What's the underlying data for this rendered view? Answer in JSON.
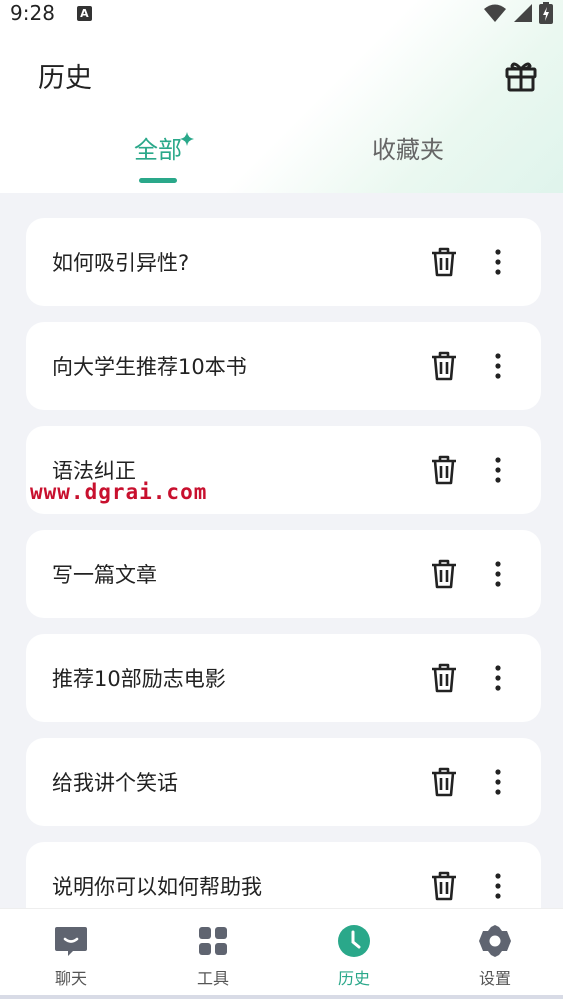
{
  "status": {
    "time": "9:28",
    "a_badge": "A"
  },
  "header": {
    "title": "历史"
  },
  "tabs": [
    {
      "label": "全部",
      "active": true
    },
    {
      "label": "收藏夹",
      "active": false
    }
  ],
  "history": [
    {
      "label": "如何吸引异性?"
    },
    {
      "label": "向大学生推荐10本书"
    },
    {
      "label": "语法纠正"
    },
    {
      "label": "写一篇文章"
    },
    {
      "label": "推荐10部励志电影"
    },
    {
      "label": "给我讲个笑话"
    },
    {
      "label": "说明你可以如何帮助我"
    }
  ],
  "watermark": "www.dgrai.com",
  "nav": [
    {
      "label": "聊天",
      "icon": "chat-icon"
    },
    {
      "label": "工具",
      "icon": "grid-icon"
    },
    {
      "label": "历史",
      "icon": "clock-icon",
      "active": true
    },
    {
      "label": "设置",
      "icon": "gear-icon"
    }
  ],
  "colors": {
    "accent": "#2aa88a",
    "icon_gray": "#5f6470",
    "background": "#f2f3f7"
  }
}
